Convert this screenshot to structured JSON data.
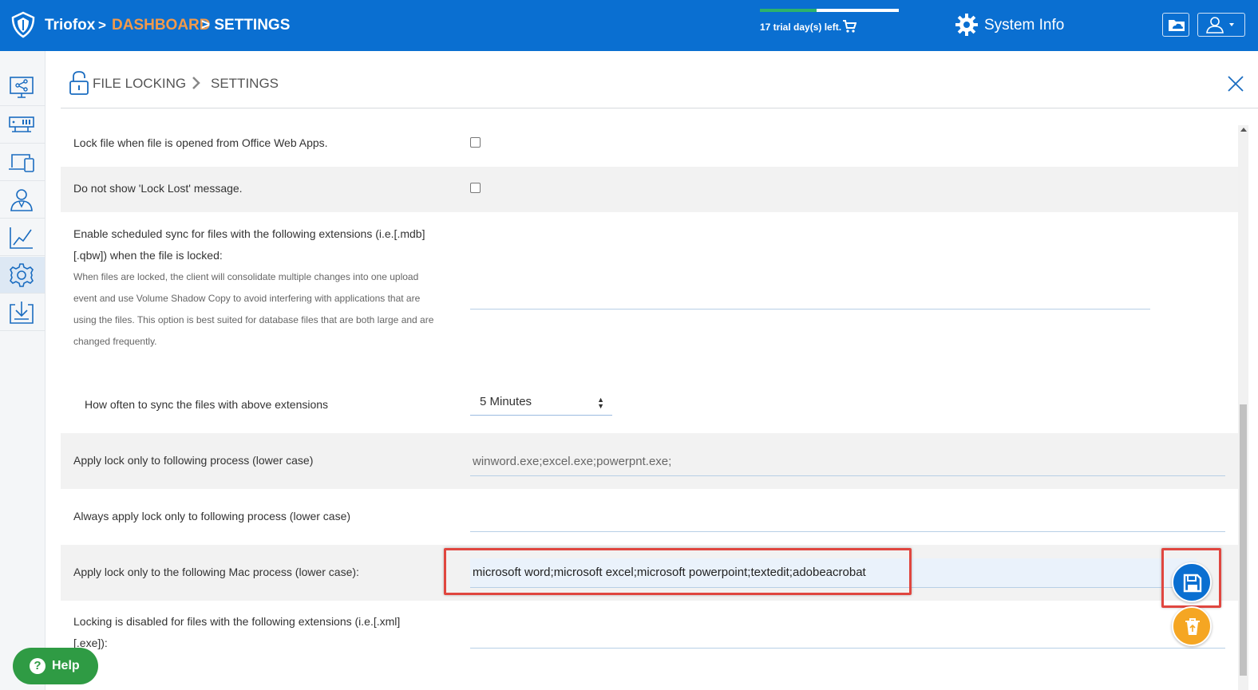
{
  "header": {
    "brand": "Triofox",
    "sep": ">",
    "crumb_dashboard": "DASHBOARD",
    "crumb_settings": "> SETTINGS",
    "trial_text": "17 trial day(s) left.",
    "trial_progress": 0.41,
    "system_info": "System Info"
  },
  "sidebar": {
    "items": [
      "share-icon",
      "server-icon",
      "devices-icon",
      "users-icon",
      "chart-icon",
      "settings-icon",
      "download-icon"
    ],
    "active": "settings-icon"
  },
  "page": {
    "title": "FILE LOCKING",
    "subtitle": "SETTINGS"
  },
  "settings": {
    "office_web_apps_label": "Lock file when file is opened from Office Web Apps.",
    "lock_lost_label": "Do not show 'Lock Lost' message.",
    "sync_label_1": "Enable scheduled sync for files with the following extensions (i.e.[.mdb]",
    "sync_label_2": "[.qbw]) when the file is locked:",
    "sync_help_1": "When files are locked, the client will consolidate multiple changes into one upload",
    "sync_help_2": "event and use Volume Shadow Copy to avoid interfering with applications that are",
    "sync_help_3": "using the files. This option is best suited for database files that are both large and are",
    "sync_help_4": "changed frequently.",
    "sync_frequency_label": "How often to sync the files with above extensions",
    "sync_frequency_value": "5 Minutes",
    "process_label": "Apply lock only to following process (lower case)",
    "process_value": "winword.exe;excel.exe;powerpnt.exe;",
    "always_process_label": "Always apply lock only to following process (lower case)",
    "mac_process_label": "Apply lock only to the following Mac process (lower case):",
    "mac_process_value": "microsoft word;microsoft excel;microsoft powerpoint;textedit;adobeacrobat",
    "disabled_ext_label_1": "Locking is disabled for files with the following extensions (i.e.[.xml]",
    "disabled_ext_label_2": "[.exe]):"
  },
  "help": {
    "label": "Help"
  },
  "colors": {
    "topbar": "#0a6fd1",
    "accent_orange": "#f39a4a",
    "highlight_red": "#e0463f",
    "help_green": "#2f9b44"
  }
}
